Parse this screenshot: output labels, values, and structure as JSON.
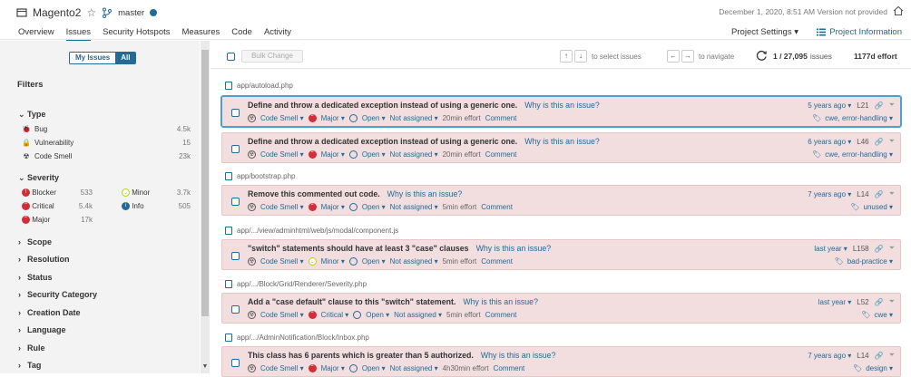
{
  "project": {
    "name": "Magento2",
    "branch": "master"
  },
  "header_right": {
    "status": "December 1, 2020, 8:51 AM  Version not provided"
  },
  "tabs": [
    {
      "label": "Overview"
    },
    {
      "label": "Issues"
    },
    {
      "label": "Security Hotspots"
    },
    {
      "label": "Measures"
    },
    {
      "label": "Code"
    },
    {
      "label": "Activity"
    }
  ],
  "project_settings": "Project Settings ▾",
  "project_information": "Project Information",
  "toggle": {
    "mine": "My Issues",
    "all": "All"
  },
  "filters": {
    "title": "Filters",
    "type": {
      "label": "Type",
      "items": [
        {
          "label": "Bug",
          "count": "4.5k"
        },
        {
          "label": "Vulnerability",
          "count": "15"
        },
        {
          "label": "Code Smell",
          "count": "23k"
        }
      ]
    },
    "severity": {
      "label": "Severity",
      "items": [
        {
          "label": "Blocker",
          "count": "533"
        },
        {
          "label": "Minor",
          "count": "3.7k"
        },
        {
          "label": "Critical",
          "count": "5.4k"
        },
        {
          "label": "Info",
          "count": "505"
        },
        {
          "label": "Major",
          "count": "17k"
        }
      ]
    },
    "collapsed": [
      "Scope",
      "Resolution",
      "Status",
      "Security Category",
      "Creation Date",
      "Language",
      "Rule",
      "Tag"
    ]
  },
  "toolbar": {
    "bulk": "Bulk Change",
    "select_hint": "to select issues",
    "nav_hint": "to navigate",
    "count": "1 / 27,095",
    "count_unit": "issues",
    "effort": "1177d effort"
  },
  "issues": [
    {
      "file": "app/autoload.php",
      "message": "Define and throw a dedicated exception instead of using a generic one.",
      "why": "Why is this an issue?",
      "type": "Code Smell ▾",
      "severity": "Major ▾",
      "status": "Open ▾",
      "assignee": "Not assigned ▾",
      "effort": "20min effort",
      "comment": "Comment",
      "age": "5 years ago ▾",
      "line": "L21",
      "tags": "cwe, error-handling ▾"
    },
    {
      "file": "",
      "message": "Define and throw a dedicated exception instead of using a generic one.",
      "why": "Why is this an issue?",
      "type": "Code Smell ▾",
      "severity": "Major ▾",
      "status": "Open ▾",
      "assignee": "Not assigned ▾",
      "effort": "20min effort",
      "comment": "Comment",
      "age": "6 years ago ▾",
      "line": "L46",
      "tags": "cwe, error-handling ▾"
    },
    {
      "file": "app/bootstrap.php",
      "message": "Remove this commented out code.",
      "why": "Why is this an issue?",
      "type": "Code Smell ▾",
      "severity": "Major ▾",
      "status": "Open ▾",
      "assignee": "Not assigned ▾",
      "effort": "5min effort",
      "comment": "Comment",
      "age": "7 years ago ▾",
      "line": "L14",
      "tags": "unused ▾"
    },
    {
      "file": "app/.../view/adminhtml/web/js/modal/component.js",
      "message": "\"switch\" statements should have at least 3 \"case\" clauses",
      "why": "Why is this an issue?",
      "type": "Code Smell ▾",
      "severity": "Minor ▾",
      "status": "Open ▾",
      "assignee": "Not assigned ▾",
      "effort": "5min effort",
      "comment": "Comment",
      "age": "last year ▾",
      "line": "L158",
      "tags": "bad-practice ▾"
    },
    {
      "file": "app/.../Block/Grid/Renderer/Severity.php",
      "message": "Add a \"case default\" clause to this \"switch\" statement.",
      "why": "Why is this an issue?",
      "type": "Code Smell ▾",
      "severity": "Critical ▾",
      "status": "Open ▾",
      "assignee": "Not assigned ▾",
      "effort": "5min effort",
      "comment": "Comment",
      "age": "last year ▾",
      "line": "L52",
      "tags": "cwe ▾"
    },
    {
      "file": "app/.../AdminNotification/Block/Inbox.php",
      "message": "This class has 6 parents which is greater than 5 authorized.",
      "why": "Why is this an issue?",
      "type": "Code Smell ▾",
      "severity": "Major ▾",
      "status": "Open ▾",
      "assignee": "Not assigned ▾",
      "effort": "4h30min effort",
      "comment": "Comment",
      "age": "7 years ago ▾",
      "line": "L14",
      "tags": "design ▾"
    }
  ]
}
